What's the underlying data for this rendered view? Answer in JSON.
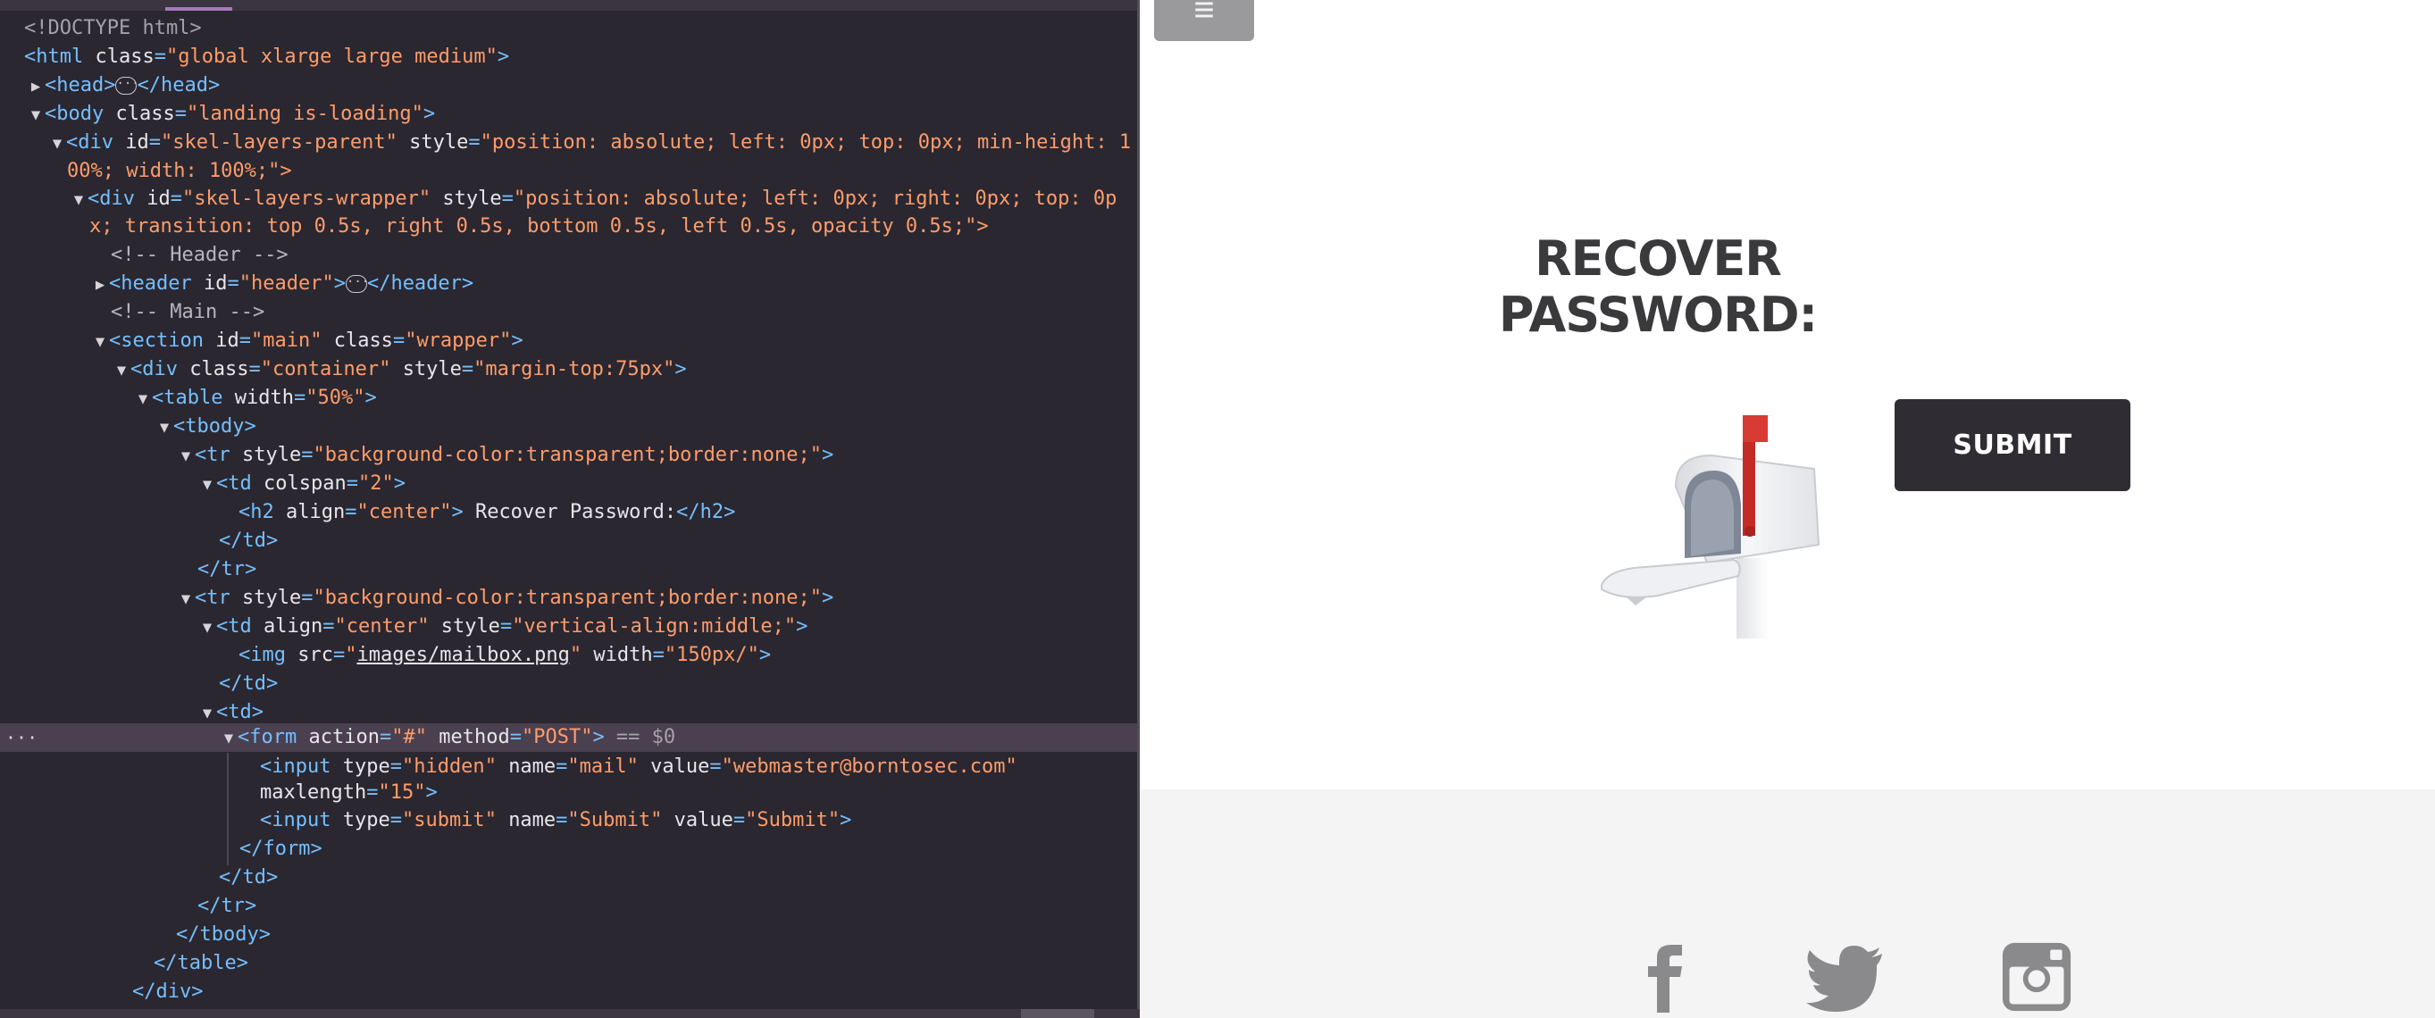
{
  "devtools": {
    "lines": [
      {
        "id": "doctype",
        "text": "<!DOCTYPE html>"
      },
      {
        "id": "html-open",
        "tag": "html",
        "attrs": [
          {
            "n": "class",
            "v": "global xlarge large medium"
          }
        ]
      },
      {
        "id": "head",
        "tag": "head",
        "attrs": []
      },
      {
        "id": "body-open",
        "tag": "body",
        "attrs": [
          {
            "n": "class",
            "v": "landing is-loading"
          }
        ]
      },
      {
        "id": "div-parent-1",
        "prefix": "div",
        "attrs": [
          {
            "n": "id",
            "v": "skel-layers-parent"
          },
          {
            "n": "style",
            "v": "position: absolute; left: 0px; top: 0px; min-height: 1"
          }
        ]
      },
      {
        "id": "div-parent-2",
        "text": "00%; width: 100%;\">"
      },
      {
        "id": "div-wrapper-1",
        "prefix": "div",
        "attrs": [
          {
            "n": "id",
            "v": "skel-layers-wrapper"
          },
          {
            "n": "style",
            "v": "position: absolute; left: 0px; right: 0px; top: 0p"
          }
        ]
      },
      {
        "id": "div-wrapper-2",
        "text": "x; transition: top 0.5s, right 0.5s, bottom 0.5s, left 0.5s, opacity 0.5s;\">"
      },
      {
        "id": "comment-header",
        "text": "<!-- Header -->"
      },
      {
        "id": "header",
        "tag": "header",
        "attrs": [
          {
            "n": "id",
            "v": "header"
          }
        ]
      },
      {
        "id": "comment-main",
        "text": "<!-- Main -->"
      },
      {
        "id": "section",
        "tag": "section",
        "attrs": [
          {
            "n": "id",
            "v": "main"
          },
          {
            "n": "class",
            "v": "wrapper"
          }
        ]
      },
      {
        "id": "div-container",
        "tag": "div",
        "attrs": [
          {
            "n": "class",
            "v": "container"
          },
          {
            "n": "style",
            "v": "margin-top:75px"
          }
        ]
      },
      {
        "id": "table",
        "tag": "table",
        "attrs": [
          {
            "n": "width",
            "v": "50%"
          }
        ]
      },
      {
        "id": "tbody",
        "tag": "tbody",
        "attrs": []
      },
      {
        "id": "tr1",
        "tag": "tr",
        "attrs": [
          {
            "n": "style",
            "v": "background-color:transparent;border:none;"
          }
        ]
      },
      {
        "id": "td1",
        "tag": "td",
        "attrs": [
          {
            "n": "colspan",
            "v": "2"
          }
        ]
      },
      {
        "id": "h2",
        "tag": "h2",
        "attrs": [
          {
            "n": "align",
            "v": "center"
          }
        ],
        "inner": " Recover Password:",
        "close": "h2"
      },
      {
        "id": "td1-close",
        "text": "</td>"
      },
      {
        "id": "tr1-close",
        "text": "</tr>"
      },
      {
        "id": "tr2",
        "tag": "tr",
        "attrs": [
          {
            "n": "style",
            "v": "background-color:transparent;border:none;"
          }
        ]
      },
      {
        "id": "td2",
        "tag": "td",
        "attrs": [
          {
            "n": "align",
            "v": "center"
          },
          {
            "n": "style",
            "v": "vertical-align:middle;"
          }
        ]
      },
      {
        "id": "img",
        "tag": "img",
        "src": "images/mailbox.png",
        "width": "150px/"
      },
      {
        "id": "td2-close",
        "text": "</td>"
      },
      {
        "id": "td3",
        "tag": "td",
        "attrs": []
      },
      {
        "id": "form",
        "tag": "form",
        "attrs": [
          {
            "n": "action",
            "v": "#"
          },
          {
            "n": "method",
            "v": "POST"
          }
        ],
        "suffix": " == $0"
      },
      {
        "id": "input-hidden-1",
        "tag": "input",
        "attrs": [
          {
            "n": "type",
            "v": "hidden"
          },
          {
            "n": "name",
            "v": "mail"
          },
          {
            "n": "value",
            "v": "webmaster@borntosec.com"
          }
        ]
      },
      {
        "id": "input-hidden-2",
        "text": "maxlength=\"15\">"
      },
      {
        "id": "input-submit",
        "tag": "input",
        "attrs": [
          {
            "n": "type",
            "v": "submit"
          },
          {
            "n": "name",
            "v": "Submit"
          },
          {
            "n": "value",
            "v": "Submit"
          }
        ]
      },
      {
        "id": "form-close",
        "text": "</form>"
      },
      {
        "id": "td3-close",
        "text": "</td>"
      },
      {
        "id": "tr2-close",
        "text": "</tr>"
      },
      {
        "id": "tbody-close",
        "text": "</tbody>"
      },
      {
        "id": "table-close",
        "text": "</table>"
      },
      {
        "id": "div-close",
        "text": "</div>"
      }
    ],
    "selected_marker": "···"
  },
  "page": {
    "menu_icon": "≡",
    "title": "RECOVER PASSWORD:",
    "submit_label": "SUBMIT",
    "social": [
      "facebook-icon",
      "twitter-icon",
      "instagram-icon"
    ]
  }
}
